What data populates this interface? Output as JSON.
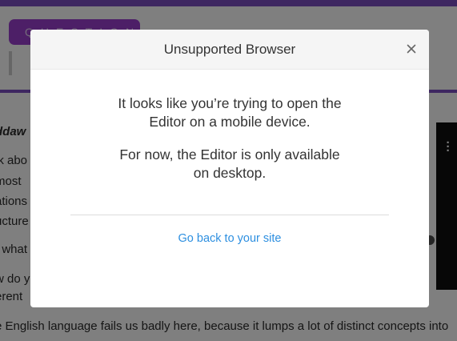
{
  "background": {
    "question_label": "QUESTION",
    "article_lines": [
      "ddaw",
      "lk abo",
      "most",
      "ations",
      "ucture",
      "t what",
      "w do y",
      "erent",
      "e English language fails us badly here, because it lumps a lot of distinct concepts into"
    ],
    "video_menu_icon": "vertical-ellipsis-icon",
    "colors": {
      "accent_bar": "#7c4fc2",
      "question_pill": "#9b3fcf"
    }
  },
  "modal": {
    "title": "Unsupported Browser",
    "close_icon": "close-icon",
    "message_1_line_1": "It looks like you’re trying to open the",
    "message_1_line_2": "Editor on a mobile device.",
    "message_2_line_1": "For now, the Editor is only available",
    "message_2_line_2": "on desktop.",
    "back_link": "Go back to your site",
    "colors": {
      "link": "#2d8fe0",
      "overlay": "rgba(0,0,0,0.5)"
    }
  }
}
